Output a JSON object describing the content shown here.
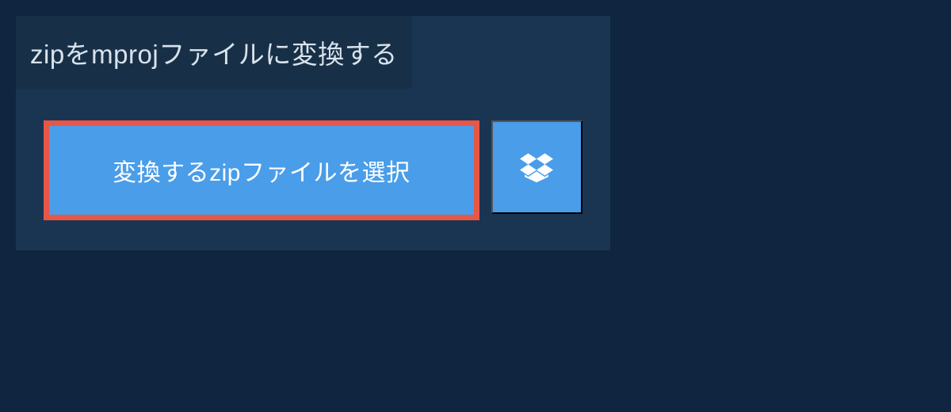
{
  "title": "zipをmprojファイルに変換する",
  "buttons": {
    "select_file_label": "変換するzipファイルを選択"
  },
  "colors": {
    "background": "#0f2540",
    "panel": "#1a3552",
    "title_bg": "#183047",
    "button_primary": "#4a9de8",
    "button_border": "#e85648",
    "text_light": "#d9e3ed"
  }
}
